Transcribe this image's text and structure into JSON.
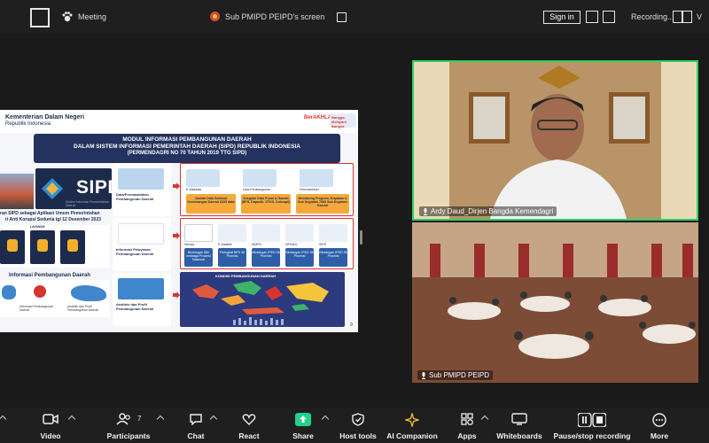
{
  "topbar": {
    "meeting_label": "Meeting",
    "screen_label": "Sub PMIPD PEIPD's screen",
    "signin_label": "Sign in",
    "recording_label": "Recording...",
    "view_label": "V"
  },
  "slide": {
    "org_name": "Kementerian Dalam Negeri",
    "org_country": "Republik Indonesia",
    "logo_left": "BerAKHLAK",
    "logo_right": "Bangga Melayani Bangsa",
    "title_line1": "MODUL INFORMASI PEMBANGUNAN DAERAH",
    "title_line2": "DALAM SISTEM INFORMASI PEMERINTAH DAERAH (SIPD) REPUBLIK INDONESIA",
    "title_line3": "(PERMENDAGRI NO 70 TAHUN 2019 TTG SIPD)",
    "sipd_logo": "SIPD",
    "sipd_tagline": "Sistem Informasi Pemerintahan Daerah",
    "caption1": "ran SIPD sebagai Aplikasi Umum Pemerintahan",
    "caption2": "ri Anti Korupsi Sedunia tgl 12 Desember 2023",
    "layanan_label": "LAYANAN",
    "info_title": "Informasi Pembangunan Daerah",
    "info_items": [
      "Informasi Pembangunan Daerah",
      "Analisis dan Profil Pembangunan Daerah"
    ],
    "flow": [
      {
        "title": "Data/Permasalahan Pembangunan Daerah"
      },
      {
        "title": "Informasi Pelayanan Pembangunan Daerah"
      },
      {
        "title": "Analisis dan Profil Pembangunan Daerah"
      }
    ],
    "row1_thumbs": [
      "E-Walidata",
      "Data Pembangunan",
      "Pemutakhiran"
    ],
    "row1_boxes": [
      "Jumlah Data Sektoral Kewenangan Daerah 6339 data",
      "Integrasi Data Pusat & Daerah (BPS, Dapodik, DTKS, Dukcapil)",
      "Monitoring Program, Kegiatan & Sub Kegiatan 7683 Sub Kegiatan Daerah"
    ],
    "row2_thumbs": [
      "Neraca",
      "E-Statistik",
      "SIMPD",
      "SIPANJI",
      "SIPD"
    ],
    "row2_boxes": [
      "Bimbingan 850 lembaga Provinsi Nasional",
      "Peringkat BPS 38 Provinsi",
      "Bimbingan IPKD 38 Provinsi",
      "Bimbingan IPKD 38 Provinsi",
      "Bimbingan IPKD 38 Provinsi"
    ],
    "map_title": "KONDISI PEMBANGUNAN DAERAH",
    "page_number": "9"
  },
  "tiles": [
    {
      "name": "Ardy Daud_Dirjen Bangda Kemendagri"
    },
    {
      "name": "Sub PMIPD PEIPD"
    }
  ],
  "toolbar": {
    "video": "Video",
    "participants": "Participants",
    "participant_count": "7",
    "chat": "Chat",
    "react": "React",
    "share": "Share",
    "host_tools": "Host tools",
    "ai_companion": "AI Companion",
    "apps": "Apps",
    "whiteboards": "Whiteboards",
    "recording": "Pause/stop recording",
    "more": "More"
  },
  "colors": {
    "active_speaker": "#2bd35f",
    "share_green": "#23d18b",
    "slide_navy": "#23325e",
    "slide_red": "#d8342f"
  }
}
